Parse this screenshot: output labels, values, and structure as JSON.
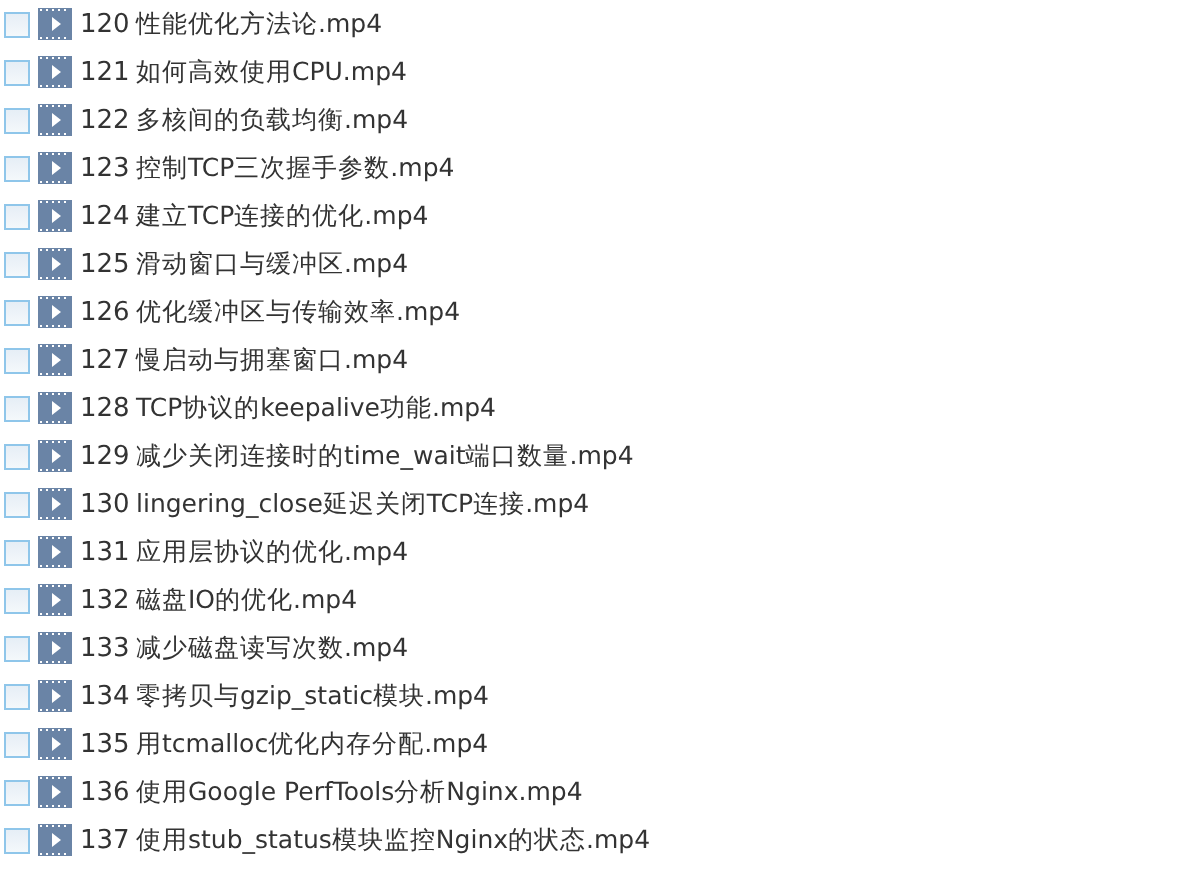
{
  "files": [
    {
      "number": "120",
      "name": "性能优化方法论.mp4",
      "checked": false
    },
    {
      "number": "121",
      "name": "如何高效使用CPU.mp4",
      "checked": false
    },
    {
      "number": "122",
      "name": "多核间的负载均衡.mp4",
      "checked": false
    },
    {
      "number": "123",
      "name": "控制TCP三次握手参数.mp4",
      "checked": false
    },
    {
      "number": "124",
      "name": "建立TCP连接的优化.mp4",
      "checked": false
    },
    {
      "number": "125",
      "name": "滑动窗口与缓冲区.mp4",
      "checked": false
    },
    {
      "number": "126",
      "name": "优化缓冲区与传输效率.mp4",
      "checked": false
    },
    {
      "number": "127",
      "name": "慢启动与拥塞窗口.mp4",
      "checked": false
    },
    {
      "number": "128",
      "name": "TCP协议的keepalive功能.mp4",
      "checked": false
    },
    {
      "number": "129",
      "name": "减少关闭连接时的time_wait端口数量.mp4",
      "checked": false
    },
    {
      "number": "130",
      "name": "lingering_close延迟关闭TCP连接.mp4",
      "checked": false
    },
    {
      "number": "131",
      "name": "应用层协议的优化.mp4",
      "checked": false
    },
    {
      "number": "132",
      "name": "磁盘IO的优化.mp4",
      "checked": false
    },
    {
      "number": "133",
      "name": "减少磁盘读写次数.mp4",
      "checked": false
    },
    {
      "number": "134",
      "name": "零拷贝与gzip_static模块.mp4",
      "checked": false
    },
    {
      "number": "135",
      "name": "用tcmalloc优化内存分配.mp4",
      "checked": false
    },
    {
      "number": "136",
      "name": "使用Google PerfTools分析Nginx.mp4",
      "checked": false
    },
    {
      "number": "137",
      "name": "使用stub_status模块监控Nginx的状态.mp4",
      "checked": false
    }
  ]
}
